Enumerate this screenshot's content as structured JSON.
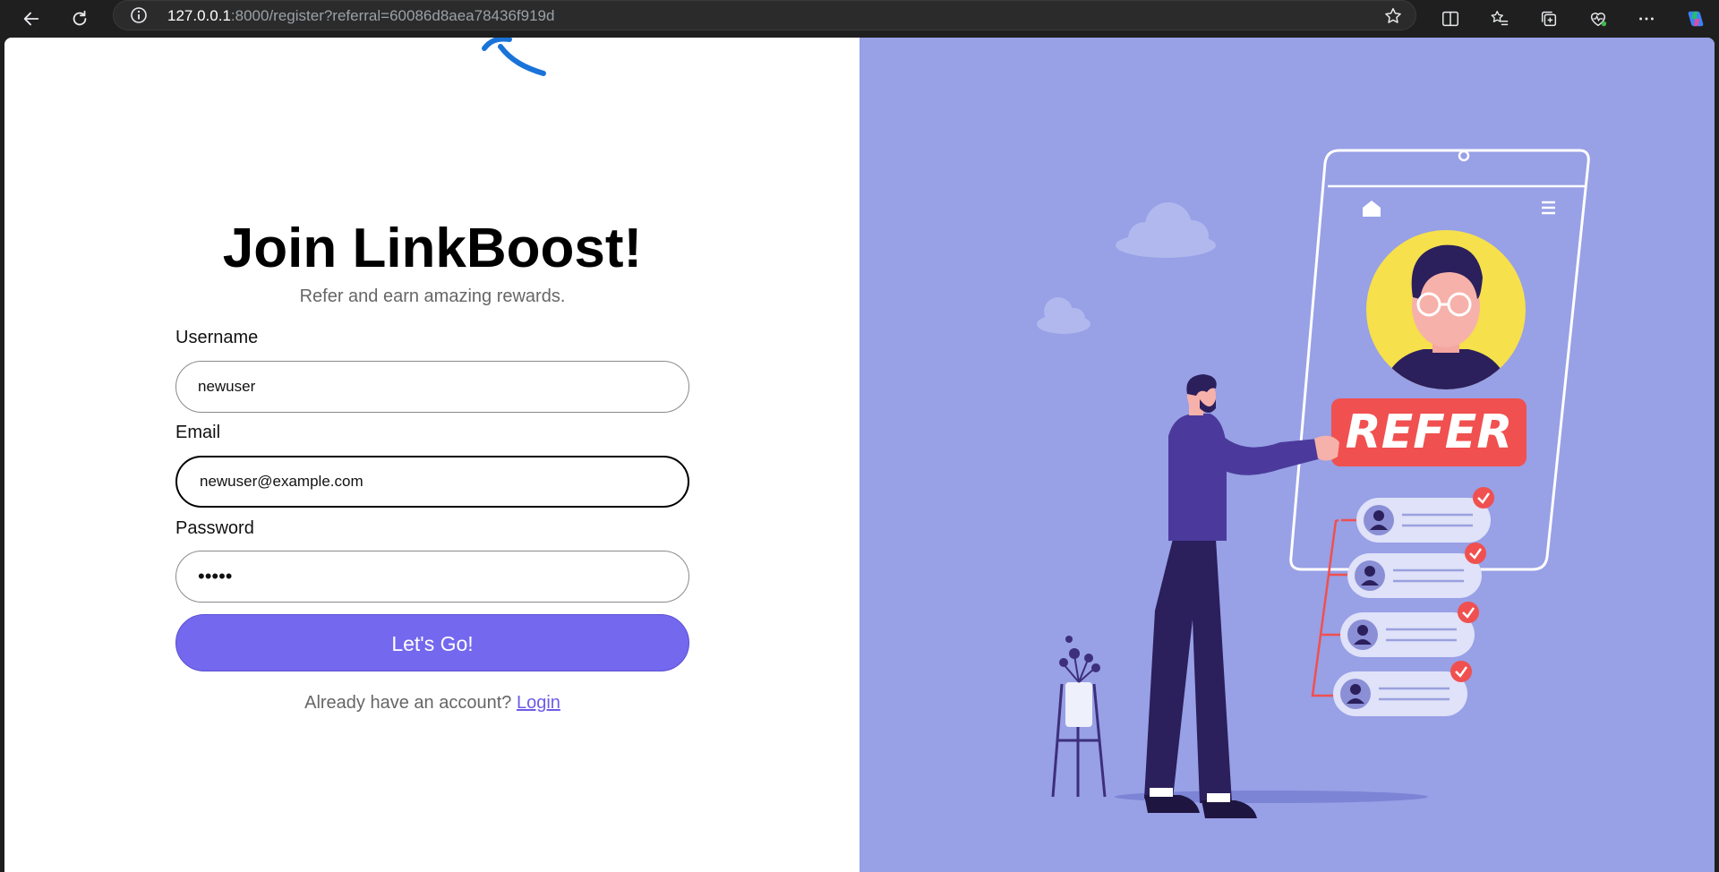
{
  "browser": {
    "url_host": "127.0.0.1",
    "url_rest": ":8000/register?referral=60086d8aea78436f919d"
  },
  "page": {
    "title": "Join LinkBoost!",
    "subtitle": "Refer and earn amazing rewards.",
    "fields": {
      "username": {
        "label": "Username",
        "value": "newuser"
      },
      "email": {
        "label": "Email",
        "value": "newuser@example.com"
      },
      "password": {
        "label": "Password",
        "value": "•••••"
      }
    },
    "submit_label": "Let's Go!",
    "login_prompt": "Already have an account?",
    "login_link": "Login"
  },
  "illustration": {
    "banner_text": "REFER"
  },
  "colors": {
    "accent": "#7468ee",
    "illustration_bg": "#98a0e6",
    "refer_red": "#f0504f"
  }
}
